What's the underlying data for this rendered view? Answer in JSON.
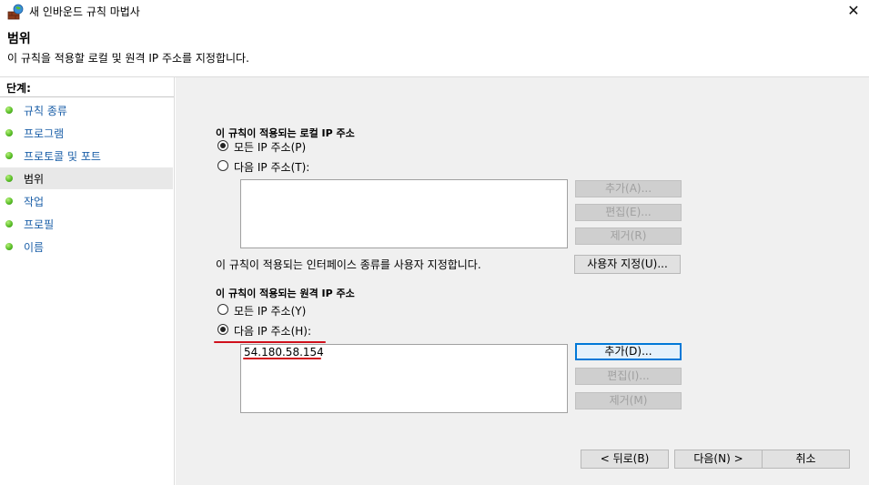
{
  "window": {
    "title": "새 인바운드 규칙 마법사",
    "close_glyph": "✕"
  },
  "header": {
    "title": "범위",
    "description": "이 규칙을 적용할 로컬 및 원격 IP 주소를 지정합니다."
  },
  "sidebar": {
    "heading": "단계:",
    "items": [
      {
        "label": "규칙 종류",
        "active": false
      },
      {
        "label": "프로그램",
        "active": false
      },
      {
        "label": "프로토콜 및 포트",
        "active": false
      },
      {
        "label": "범위",
        "active": true
      },
      {
        "label": "작업",
        "active": false
      },
      {
        "label": "프로필",
        "active": false
      },
      {
        "label": "이름",
        "active": false
      }
    ]
  },
  "local": {
    "group_label": "이 규칙이 적용되는 로컬 IP 주소",
    "option_any": "모든 IP 주소(P)",
    "option_specific": "다음 IP 주소(T):",
    "selected": "any",
    "addresses": [],
    "add_label": "추가(A)...",
    "edit_label": "편집(E)...",
    "remove_label": "제거(R)"
  },
  "interface": {
    "text": "이 규칙이 적용되는 인터페이스 종류를 사용자 지정합니다.",
    "customize_label": "사용자 지정(U)..."
  },
  "remote": {
    "group_label": "이 규칙이 적용되는 원격 IP 주소",
    "option_any": "모든 IP 주소(Y)",
    "option_specific": "다음 IP 주소(H):",
    "selected": "specific",
    "addresses": [
      "54.180.58.154"
    ],
    "add_label": "추가(D)...",
    "edit_label": "편집(I)...",
    "remove_label": "제거(M)"
  },
  "footer": {
    "back_label": "< 뒤로(B)",
    "next_label": "다음(N) >",
    "cancel_label": "취소"
  },
  "colors": {
    "annotation_underline": "#d0101c",
    "step_link": "#1b5fa8",
    "focus_border": "#0078d7"
  }
}
